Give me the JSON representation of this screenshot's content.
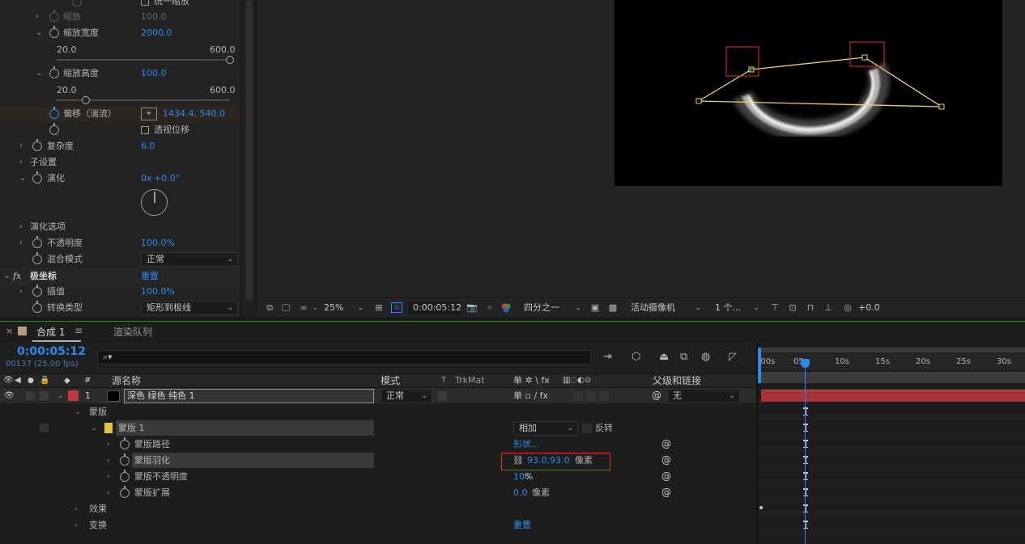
{
  "fx_panel": {
    "uniform_scale_label": "统一缩放",
    "scale_label": "缩放",
    "scale_value": "100.0",
    "scale_width_label": "缩放宽度",
    "scale_width_value": "2000.0",
    "sw_min": "20.0",
    "sw_max": "600.0",
    "scale_height_label": "缩放高度",
    "scale_height_value": "100.0",
    "sh_min": "20.0",
    "sh_max": "600.0",
    "offset_label": "偏移（湍流）",
    "offset_value": "1434.4, 540.0",
    "perspective_label": "透视位移",
    "complexity_label": "复杂度",
    "complexity_value": "6.0",
    "sub_settings_label": "子设置",
    "evolution_label": "演化",
    "evolution_value_rev": "0x",
    "evolution_value_deg": "+0.0°",
    "evolution_options_label": "演化选项",
    "opacity_label": "不透明度",
    "opacity_value": "100.0%",
    "blend_mode_label": "混合模式",
    "blend_mode_value": "正常",
    "polar_fx_badge": "fx",
    "polar_label": "极坐标",
    "polar_reset": "重置",
    "interp_label": "插值",
    "interp_value": "100.0%",
    "convert_label": "转换类型",
    "convert_value": "矩形到极线"
  },
  "viewer_toolbar": {
    "zoom": "25%",
    "timecode": "0:00:05:12",
    "resolution": "四分之一",
    "camera": "活动摄像机",
    "views": "1 个...",
    "exposure": "+0.0"
  },
  "timeline": {
    "tab_comp": "合成 1",
    "tab_render": "渲染队列",
    "timecode": "0:00:05:12",
    "frame_info": "00137 (25.00 fps)",
    "search_icon": "search-icon",
    "col_num": "#",
    "col_source": "源名称",
    "col_mode": "模式",
    "col_t": "T",
    "col_trkmat": "TrkMat",
    "col_switches": "单 ✲ \\ fx",
    "col_parent": "父级和链接",
    "ruler": [
      ":00s",
      "05s",
      "10s",
      "15s",
      "20s",
      "25s",
      "30s"
    ],
    "layer": {
      "index": "1",
      "name": "深色 绿色 纯色 1",
      "mode": "正常",
      "parent": "无"
    },
    "rows": {
      "masks": "蒙版",
      "mask1": "蒙版 1",
      "mask1_mode": "相加",
      "mask1_invert": "反转",
      "mask_path": "蒙版路径",
      "mask_path_value": "形状...",
      "mask_feather": "蒙版羽化",
      "mask_feather_value": "93.0,93.0",
      "mask_feather_unit": "像素",
      "mask_opacity": "蒙版不透明度",
      "mask_opacity_value": "100",
      "mask_opacity_unit": "%",
      "mask_expansion": "蒙版扩展",
      "mask_expansion_value": "0.0",
      "mask_expansion_unit": "像素",
      "effects": "效果",
      "transform": "变换",
      "transform_reset": "重置"
    }
  },
  "colors": {
    "accent": "#2d8ceb",
    "layer_label": "#c0393d",
    "mask_label": "#e6c435",
    "highlight_box": "#e03030",
    "mask_path": "#e6d27a"
  }
}
